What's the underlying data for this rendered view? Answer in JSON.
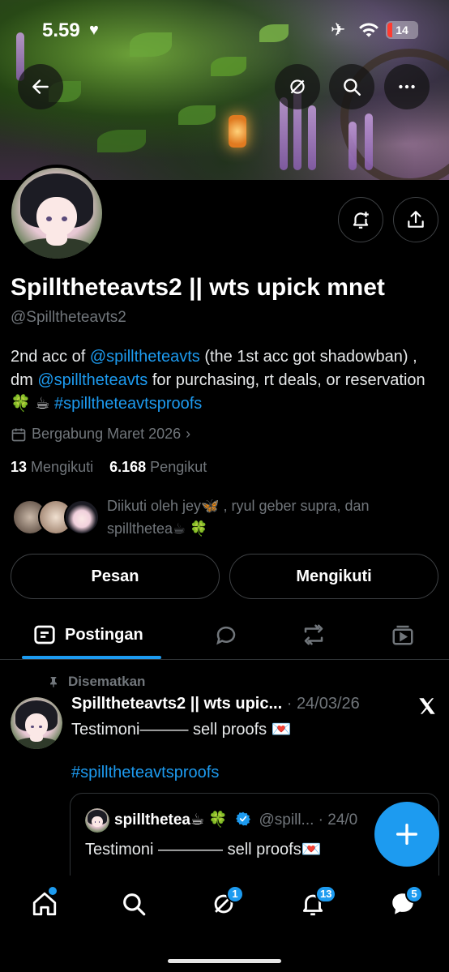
{
  "status_bar": {
    "time": "5.59",
    "heart_icon": "heart-icon",
    "battery": "14"
  },
  "profile": {
    "name": "Spilltheteavts2 || wts upick mnet",
    "handle": "@Spilltheteavts2",
    "bio": {
      "p1": "2nd acc of ",
      "link1": "@spilltheteavts",
      "p2": " (the 1st acc got shadowban) , dm ",
      "link2": "@spilltheteavts",
      "p3": " for purchasing, rt deals, or reservation 🍀 ☕ ",
      "hashtag": "#spilltheteavtsproofs"
    },
    "joined": "Bergabung Maret 2026",
    "following_count": "13",
    "following_label": "Mengikuti",
    "followers_count": "6.168",
    "followers_label": "Pengikut",
    "followed_by": "Diikuti oleh jey🦋 , ryul geber supra, dan spillthetea☕ 🍀"
  },
  "actions": {
    "message": "Pesan",
    "following": "Mengikuti"
  },
  "tabs": {
    "active_label": "Postingan"
  },
  "post": {
    "pinned_label": "Disematkan",
    "author": "Spilltheteavts2 || wts upic...",
    "date": "24/03/26",
    "text": "Testimoni——— sell proofs 💌",
    "hashtag": "#spilltheteavtsproofs",
    "quote": {
      "author": "spillthetea☕ 🍀",
      "handle": "@spill...",
      "date": "· 24/0",
      "text": "Testimoni ———— sell proofs💌"
    }
  },
  "bottom_nav": {
    "spaces_badge": "1",
    "notifications_badge": "13",
    "messages_badge": "5"
  },
  "colors": {
    "accent": "#1d9bf0",
    "background": "#000000",
    "muted": "#71767b"
  }
}
